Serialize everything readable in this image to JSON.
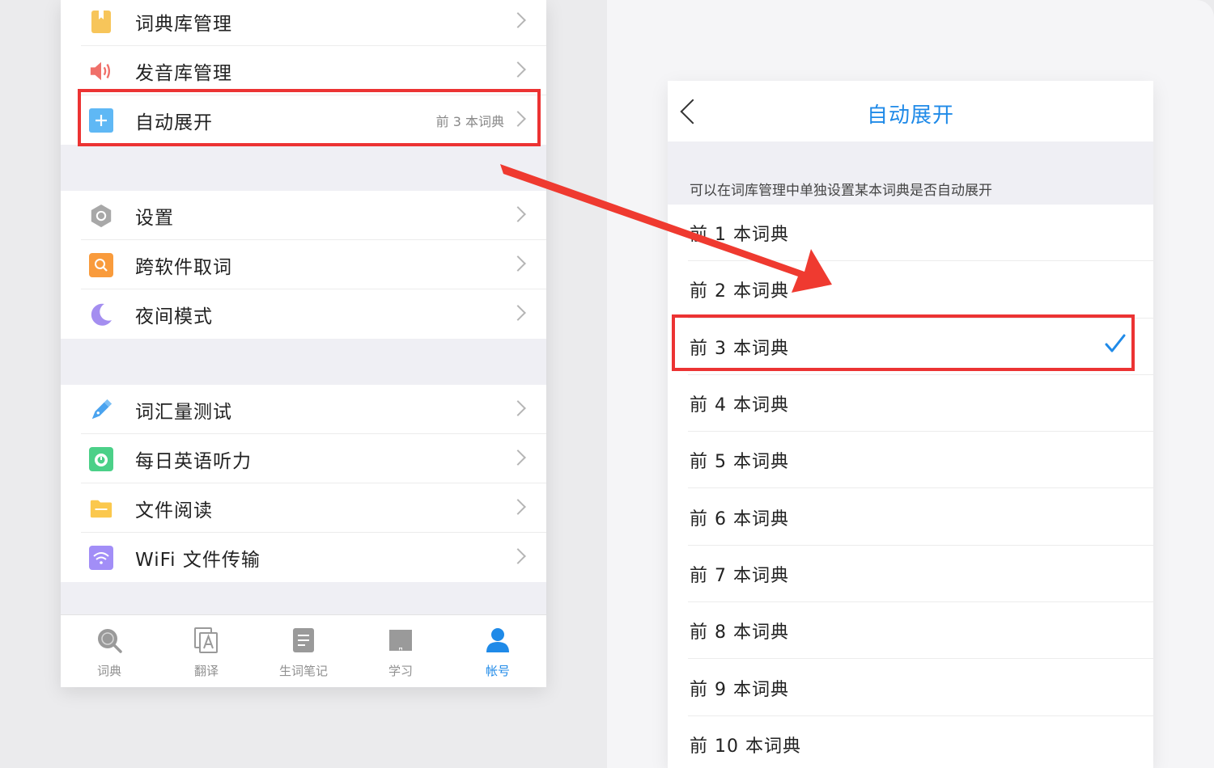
{
  "left_menu": {
    "group1": [
      {
        "label": "词典库管理",
        "icon": "dict-library-icon",
        "color": "#f7c55a"
      },
      {
        "label": "发音库管理",
        "icon": "speaker-icon",
        "color": "#f0706a"
      },
      {
        "label": "自动展开",
        "icon": "plus-icon",
        "color": "#5fb8f5",
        "value": "前 3 本词典"
      }
    ],
    "group2": [
      {
        "label": "设置",
        "icon": "gear-icon",
        "color": "#a8a8a8"
      },
      {
        "label": "跨软件取词",
        "icon": "search-icon",
        "color": "#f99b3c"
      },
      {
        "label": "夜间模式",
        "icon": "moon-icon",
        "color": "#a48ef0"
      }
    ],
    "group3": [
      {
        "label": "词汇量测试",
        "icon": "pen-icon",
        "color": "#4aa3ef"
      },
      {
        "label": "每日英语听力",
        "icon": "headphone-icon",
        "color": "#4bd088"
      },
      {
        "label": "文件阅读",
        "icon": "folder-icon",
        "color": "#fbc84d"
      },
      {
        "label": "WiFi 文件传输",
        "icon": "wifi-icon",
        "color": "#a28ef7"
      }
    ]
  },
  "tabbar": [
    {
      "label": "词典",
      "icon": "search-tab-icon",
      "active": false
    },
    {
      "label": "翻译",
      "icon": "translate-icon",
      "active": false
    },
    {
      "label": "生词笔记",
      "icon": "note-icon",
      "active": false
    },
    {
      "label": "学习",
      "icon": "book-icon",
      "active": false
    },
    {
      "label": "帐号",
      "icon": "account-icon",
      "active": true
    }
  ],
  "detail": {
    "title": "自动展开",
    "hint": "可以在词库管理中单独设置某本词典是否自动展开",
    "options": [
      "前 1 本词典",
      "前 2 本词典",
      "前 3 本词典",
      "前 4 本词典",
      "前 5 本词典",
      "前 6 本词典",
      "前 7 本词典",
      "前 8 本词典",
      "前 9 本词典",
      "前 10 本词典"
    ],
    "selected_index": 2
  },
  "colors": {
    "accent": "#1f8ae8",
    "highlight": "#ec3333",
    "inactive_tab": "#909090"
  }
}
